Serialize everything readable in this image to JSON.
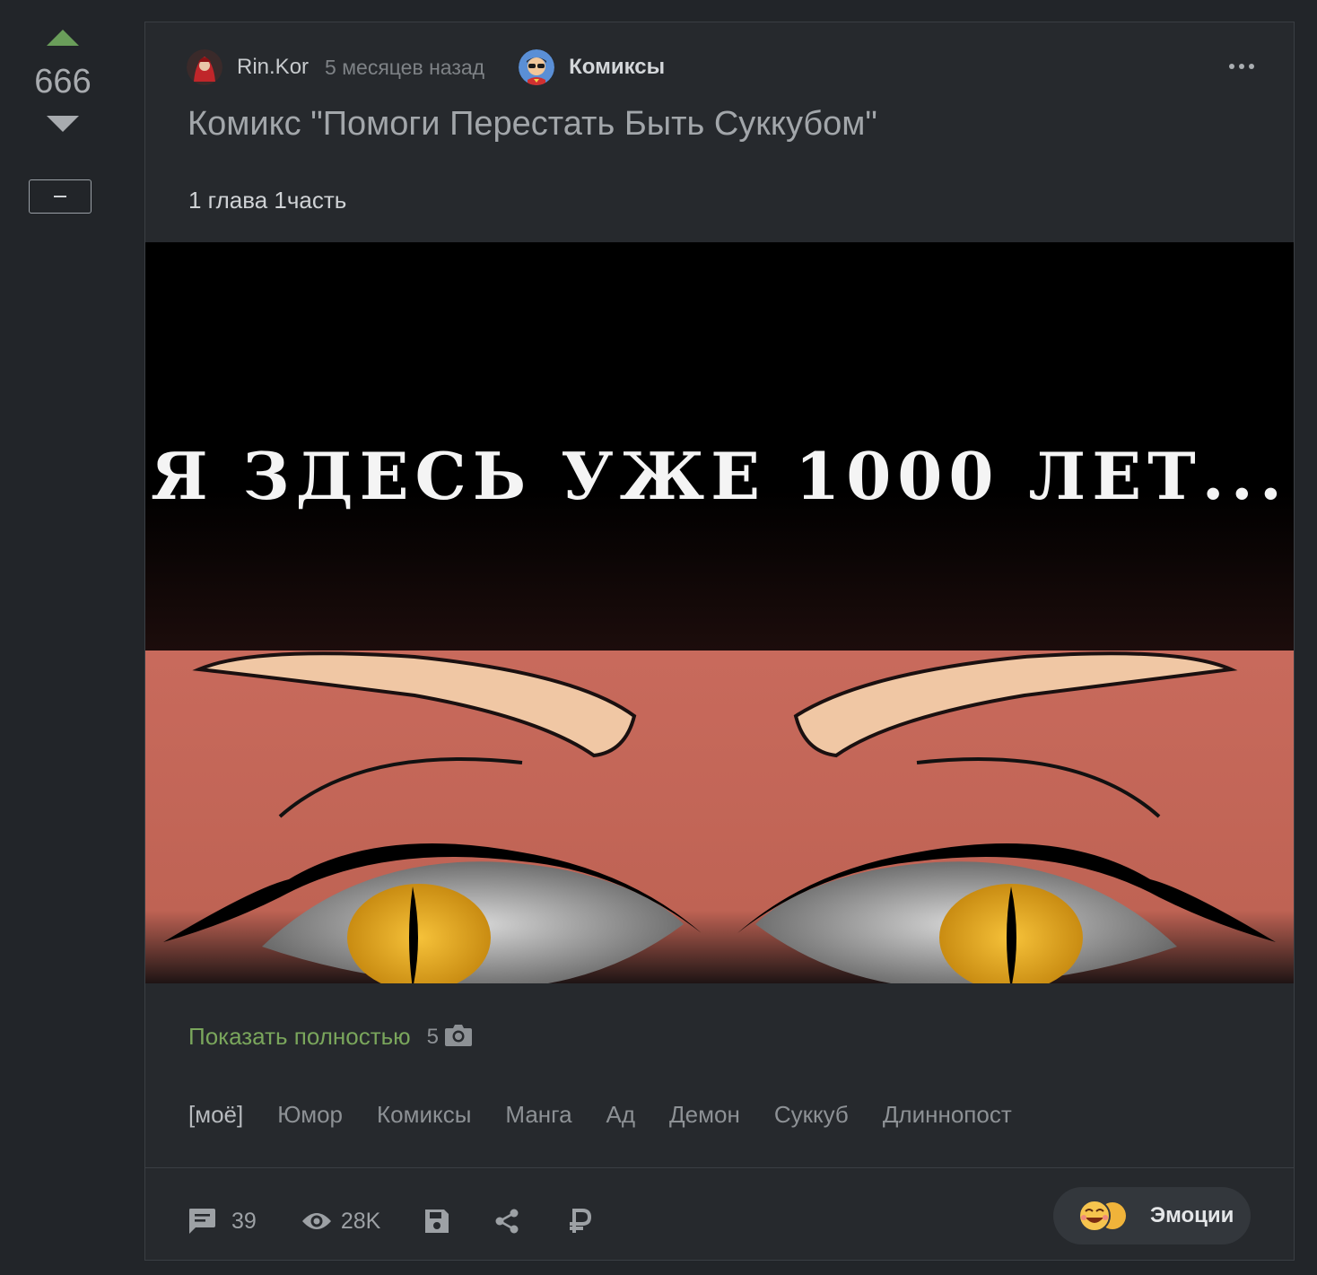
{
  "vote": {
    "score": "666"
  },
  "post": {
    "author": "Rin.Kor",
    "time": "5 месяцев назад",
    "community": "Комиксы",
    "title": "Комикс \"Помоги Перестать Быть Суккубом\"",
    "subtitle": "1 глава 1часть",
    "image_caption": "Я ЗДЕСЬ УЖЕ 1000 ЛЕТ...",
    "show_full_label": "Показать полностью",
    "photo_count": "5",
    "tags": [
      "[моё]",
      "Юмор",
      "Комиксы",
      "Манга",
      "Ад",
      "Демон",
      "Суккуб",
      "Длиннопост"
    ]
  },
  "footer": {
    "comments": "39",
    "views": "28K",
    "emotions_label": "Эмоции"
  },
  "colors": {
    "accent_green": "#7aa65c",
    "background": "#222529",
    "card": "#26292d"
  }
}
